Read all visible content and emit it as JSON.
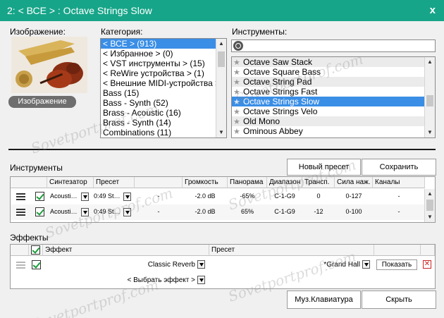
{
  "window": {
    "title": "2: < ВСЕ > : Octave Strings Slow",
    "close": "x"
  },
  "image_section": {
    "label": "Изображение:",
    "button": "Изображение"
  },
  "category": {
    "label": "Категория:",
    "items": [
      "< ВСЕ > (913)",
      "< Избранное > (0)",
      "< VST инструменты > (15)",
      "< ReWire устройства > (1)",
      "< Внешние MIDI-устройства >",
      "Bass (15)",
      "Bass - Synth (52)",
      "Brass - Acoustic (16)",
      "Brass - Synth (14)",
      "Combinations (11)"
    ],
    "selected_index": 0
  },
  "instruments_list": {
    "label": "Инструменты:",
    "search_placeholder": "",
    "items": [
      "Octave Saw Stack",
      "Octave Square Bass",
      "Octave String Pad",
      "Octave Strings Fast",
      "Octave Strings Slow",
      "Octave Strings Velo",
      "Old Mono",
      "Ominous Abbey"
    ],
    "selected_index": 4
  },
  "tracks": {
    "label": "Инструменты",
    "new_preset": "Новый пресет",
    "save": "Сохранить",
    "columns": [
      "Синтезатор",
      "Пресет",
      "Громкость",
      "Панорама",
      "Диапазон",
      "Трансп.",
      "Сила наж.",
      "Каналы"
    ],
    "rows": [
      {
        "synth": "Acousti…",
        "preset": "0:49 St…",
        "dash": "-",
        "volume": "-2.0 dB",
        "pan": "-65%",
        "range": "C-1-G9",
        "transpose": "0",
        "velocity": "0-127",
        "channels": "-"
      },
      {
        "synth": "Acousti…",
        "preset": "0:49 St…",
        "dash": "-",
        "volume": "-2.0 dB",
        "pan": "65%",
        "range": "C-1-G9",
        "transpose": "-12",
        "velocity": "0-100",
        "channels": "-"
      }
    ]
  },
  "effects": {
    "label": "Эффекты",
    "col_effect": "Эффект",
    "col_preset": "Пресет",
    "rows": [
      {
        "effect": "Classic Reverb",
        "preset": "*Grand Hall",
        "show": "Показать"
      }
    ],
    "choose": "< Выбрать эффект >"
  },
  "footer": {
    "keyboard": "Муз.Клавиатура",
    "hide": "Скрыть"
  },
  "watermark_text": "Sovetportprof.com",
  "colors": {
    "title_bar": "#17a589",
    "selection": "#3a8ee6"
  }
}
